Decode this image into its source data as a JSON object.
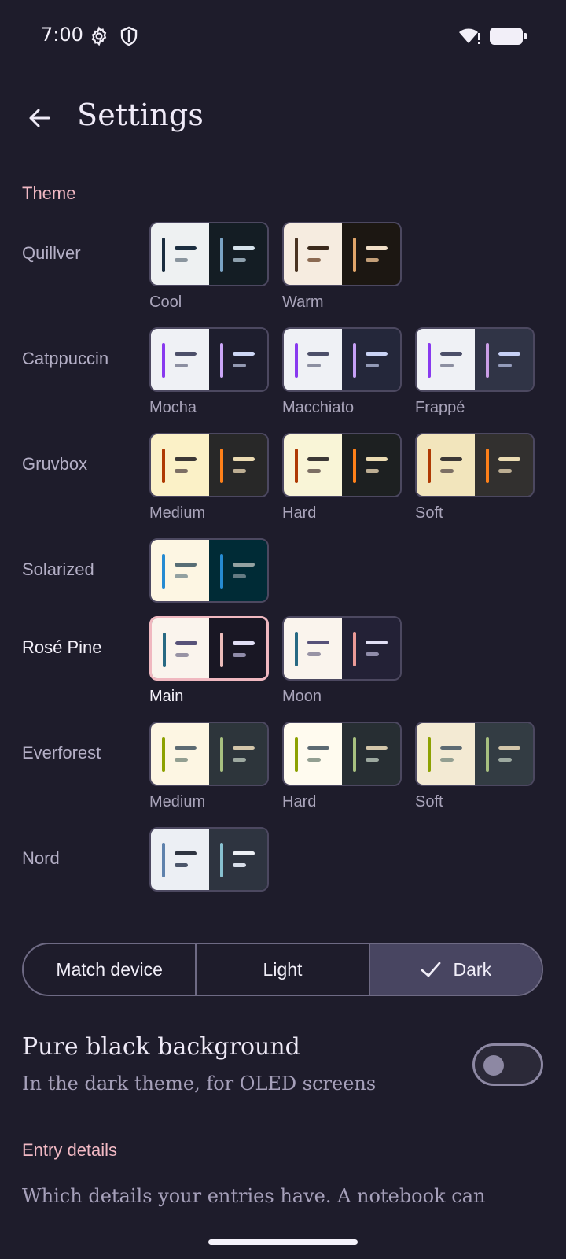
{
  "status_bar": {
    "time": "7:00",
    "icons": [
      "gear-icon",
      "shield-icon",
      "wifi-icon",
      "battery-icon"
    ]
  },
  "app_bar": {
    "back_icon": "arrow-back-icon",
    "title": "Settings"
  },
  "theme_section": {
    "label": "Theme",
    "families": [
      {
        "name": "Quillver",
        "variants": [
          {
            "label": "Cool",
            "light": {
              "bg": "#eef1f2",
              "bar": "#1b2d3f",
              "l1": "#1b2d3f",
              "l2": "#8a959e"
            },
            "dark": {
              "bg": "#141d24",
              "bar": "#7aa3c4",
              "l1": "#d7e3ec",
              "l2": "#8ea0ad"
            }
          },
          {
            "label": "Warm",
            "light": {
              "bg": "#f6ece0",
              "bar": "#4a3422",
              "l1": "#3b2a1c",
              "l2": "#8b6a52"
            },
            "dark": {
              "bg": "#1c1712",
              "bar": "#e0a56a",
              "l1": "#f1dfc8",
              "l2": "#c39f78"
            }
          }
        ]
      },
      {
        "name": "Catppuccin",
        "variants": [
          {
            "label": "Mocha",
            "light": {
              "bg": "#eff1f5",
              "bar": "#8839ef",
              "l1": "#4c4f69",
              "l2": "#8c8fa1"
            },
            "dark": {
              "bg": "#1e1e2e",
              "bar": "#cba6f7",
              "l1": "#cdd6f4",
              "l2": "#9399b2"
            }
          },
          {
            "label": "Macchiato",
            "light": {
              "bg": "#eff1f5",
              "bar": "#8839ef",
              "l1": "#4c4f69",
              "l2": "#8c8fa1"
            },
            "dark": {
              "bg": "#24273a",
              "bar": "#c6a0f6",
              "l1": "#cad3f5",
              "l2": "#939ab7"
            }
          },
          {
            "label": "Frappé",
            "light": {
              "bg": "#eff1f5",
              "bar": "#8839ef",
              "l1": "#4c4f69",
              "l2": "#8c8fa1"
            },
            "dark": {
              "bg": "#303446",
              "bar": "#ca9ee6",
              "l1": "#c6d0f5",
              "l2": "#949cbb"
            }
          }
        ]
      },
      {
        "name": "Gruvbox",
        "variants": [
          {
            "label": "Medium",
            "light": {
              "bg": "#fbf1c7",
              "bar": "#af3a03",
              "l1": "#3c3836",
              "l2": "#7c6f64"
            },
            "dark": {
              "bg": "#282828",
              "bar": "#fe8019",
              "l1": "#ebdbb2",
              "l2": "#bdae93"
            }
          },
          {
            "label": "Hard",
            "light": {
              "bg": "#f9f5d7",
              "bar": "#af3a03",
              "l1": "#3c3836",
              "l2": "#7c6f64"
            },
            "dark": {
              "bg": "#1d2021",
              "bar": "#fe8019",
              "l1": "#ebdbb2",
              "l2": "#bdae93"
            }
          },
          {
            "label": "Soft",
            "light": {
              "bg": "#f2e5bc",
              "bar": "#af3a03",
              "l1": "#3c3836",
              "l2": "#7c6f64"
            },
            "dark": {
              "bg": "#32302f",
              "bar": "#fe8019",
              "l1": "#ebdbb2",
              "l2": "#bdae93"
            }
          }
        ]
      },
      {
        "name": "Solarized",
        "variants": [
          {
            "label": "",
            "light": {
              "bg": "#fdf6e3",
              "bar": "#268bd2",
              "l1": "#586e75",
              "l2": "#93a1a1"
            },
            "dark": {
              "bg": "#002b36",
              "bar": "#268bd2",
              "l1": "#93a1a1",
              "l2": "#657b83"
            }
          }
        ]
      },
      {
        "name": "Rosé Pine",
        "selected": true,
        "variants": [
          {
            "label": "Main",
            "selected": true,
            "light": {
              "bg": "#faf4ed",
              "bar": "#286983",
              "l1": "#575279",
              "l2": "#9893a5"
            },
            "dark": {
              "bg": "#191724",
              "bar": "#ebbcba",
              "l1": "#e0def4",
              "l2": "#908caa"
            }
          },
          {
            "label": "Moon",
            "light": {
              "bg": "#faf4ed",
              "bar": "#286983",
              "l1": "#575279",
              "l2": "#9893a5"
            },
            "dark": {
              "bg": "#232136",
              "bar": "#ea9a97",
              "l1": "#e0def4",
              "l2": "#908caa"
            }
          }
        ]
      },
      {
        "name": "Everforest",
        "variants": [
          {
            "label": "Medium",
            "light": {
              "bg": "#fdf6e3",
              "bar": "#8da101",
              "l1": "#5c6a72",
              "l2": "#939f91"
            },
            "dark": {
              "bg": "#2d353b",
              "bar": "#a7c080",
              "l1": "#d3c6aa",
              "l2": "#9da9a0"
            }
          },
          {
            "label": "Hard",
            "light": {
              "bg": "#fffbef",
              "bar": "#8da101",
              "l1": "#5c6a72",
              "l2": "#939f91"
            },
            "dark": {
              "bg": "#272e33",
              "bar": "#a7c080",
              "l1": "#d3c6aa",
              "l2": "#9da9a0"
            }
          },
          {
            "label": "Soft",
            "light": {
              "bg": "#f3ead3",
              "bar": "#8da101",
              "l1": "#5c6a72",
              "l2": "#939f91"
            },
            "dark": {
              "bg": "#333c43",
              "bar": "#a7c080",
              "l1": "#d3c6aa",
              "l2": "#9da9a0"
            }
          }
        ]
      },
      {
        "name": "Nord",
        "variants": [
          {
            "label": "",
            "light": {
              "bg": "#eceff4",
              "bar": "#5e81ac",
              "l1": "#2e3440",
              "l2": "#4c566a"
            },
            "dark": {
              "bg": "#2e3440",
              "bar": "#88c0d0",
              "l1": "#eceff4",
              "l2": "#d8dee9"
            }
          }
        ]
      }
    ]
  },
  "mode_selector": {
    "options": [
      "Match device",
      "Light",
      "Dark"
    ],
    "selected": "Dark"
  },
  "pure_black": {
    "title": "Pure black background",
    "subtitle": "In the dark theme, for OLED screens",
    "enabled": false
  },
  "entry_details": {
    "label": "Entry details",
    "text": "Which details your entries have. A notebook can choose its own instead (hold it in the notebook list, then Edit)."
  },
  "colors": {
    "background": "#1e1c2b",
    "accent": "#f2b9c4",
    "selected_segment": "#484561"
  }
}
